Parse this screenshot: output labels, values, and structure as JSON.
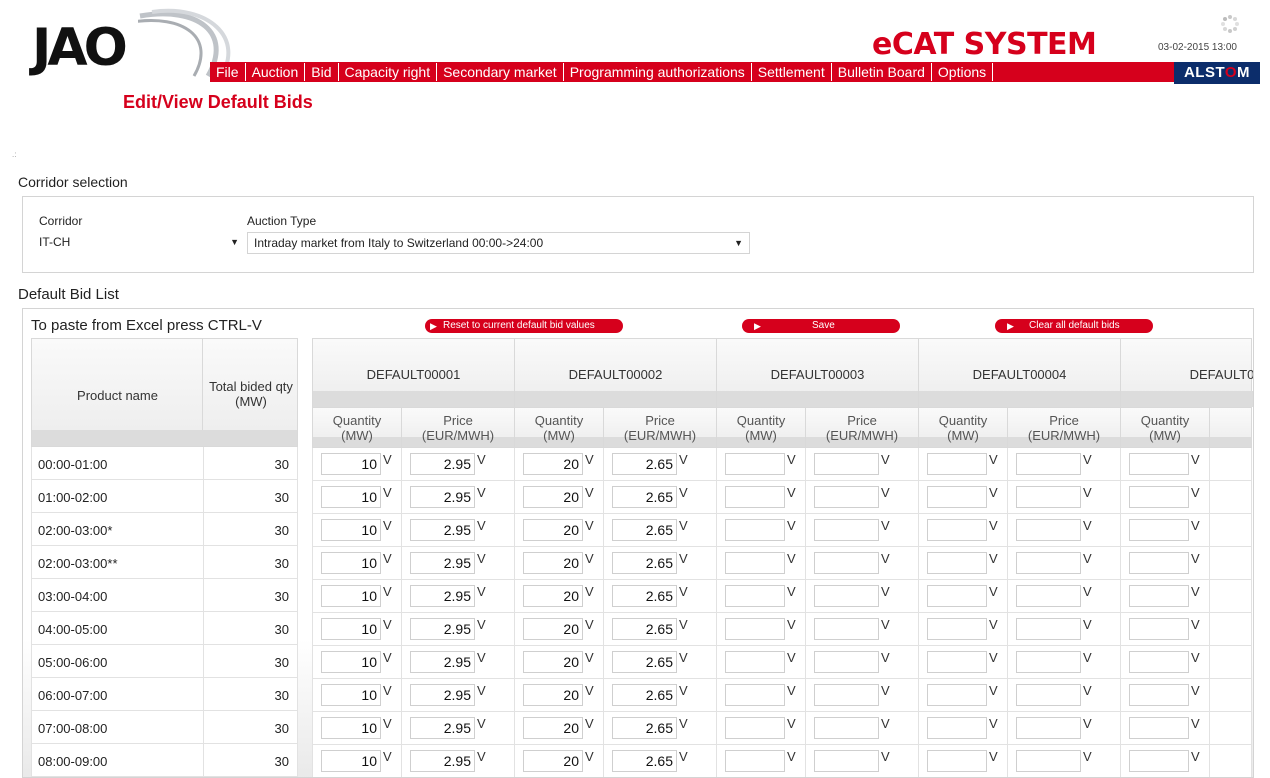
{
  "header": {
    "logo_text": "JAO",
    "menu": [
      "File",
      "Auction",
      "Bid",
      "Capacity right",
      "Secondary market",
      "Programming authorizations",
      "Settlement",
      "Bulletin Board",
      "Options"
    ],
    "system_title": "eCAT SYSTEM",
    "datetime": "03-02-2015 13:00",
    "brand": "ALSTOM",
    "brand_pre": "ALST",
    "brand_o": "O",
    "brand_post": "M",
    "page_title": "Edit/View Default Bids",
    "tiny_marker": ".:"
  },
  "corridor": {
    "section_title": "Corridor selection",
    "corridor_label": "Corridor",
    "corridor_value": "IT-CH",
    "auction_type_label": "Auction Type",
    "auction_type_value": "Intraday market from Italy to Switzerland 00:00->24:00"
  },
  "bids": {
    "section_title": "Default Bid List",
    "paste_hint": "To paste from Excel press CTRL-V",
    "btn_reset": "Reset to current default bid values",
    "btn_save": "Save",
    "btn_clear": "Clear all default bids",
    "col_product": "Product name",
    "col_total_1": "Total bided qty",
    "col_total_2": "(MW)",
    "qty_1": "Quantity",
    "qty_2": "(MW)",
    "price_1": "Price",
    "price_2": "(EUR/MWH)",
    "v_marker": "V",
    "defaults": [
      "DEFAULT00001",
      "DEFAULT00002",
      "DEFAULT00003",
      "DEFAULT00004",
      "DEFAULT0"
    ],
    "rows": [
      {
        "product": "00:00-01:00",
        "total": "30",
        "values": [
          "10",
          "2.95",
          "20",
          "2.65",
          "",
          "",
          "",
          "",
          ""
        ]
      },
      {
        "product": "01:00-02:00",
        "total": "30",
        "values": [
          "10",
          "2.95",
          "20",
          "2.65",
          "",
          "",
          "",
          "",
          ""
        ]
      },
      {
        "product": "02:00-03:00*",
        "total": "30",
        "values": [
          "10",
          "2.95",
          "20",
          "2.65",
          "",
          "",
          "",
          "",
          ""
        ]
      },
      {
        "product": "02:00-03:00**",
        "total": "30",
        "values": [
          "10",
          "2.95",
          "20",
          "2.65",
          "",
          "",
          "",
          "",
          ""
        ]
      },
      {
        "product": "03:00-04:00",
        "total": "30",
        "values": [
          "10",
          "2.95",
          "20",
          "2.65",
          "",
          "",
          "",
          "",
          ""
        ]
      },
      {
        "product": "04:00-05:00",
        "total": "30",
        "values": [
          "10",
          "2.95",
          "20",
          "2.65",
          "",
          "",
          "",
          "",
          ""
        ]
      },
      {
        "product": "05:00-06:00",
        "total": "30",
        "values": [
          "10",
          "2.95",
          "20",
          "2.65",
          "",
          "",
          "",
          "",
          ""
        ]
      },
      {
        "product": "06:00-07:00",
        "total": "30",
        "values": [
          "10",
          "2.95",
          "20",
          "2.65",
          "",
          "",
          "",
          "",
          ""
        ]
      },
      {
        "product": "07:00-08:00",
        "total": "30",
        "values": [
          "10",
          "2.95",
          "20",
          "2.65",
          "",
          "",
          "",
          "",
          ""
        ]
      },
      {
        "product": "08:00-09:00",
        "total": "30",
        "values": [
          "10",
          "2.95",
          "20",
          "2.65",
          "",
          "",
          "",
          "",
          ""
        ]
      }
    ]
  },
  "colors": {
    "accent_red": "#d6001c",
    "alstom_blue": "#0c2d6b"
  }
}
